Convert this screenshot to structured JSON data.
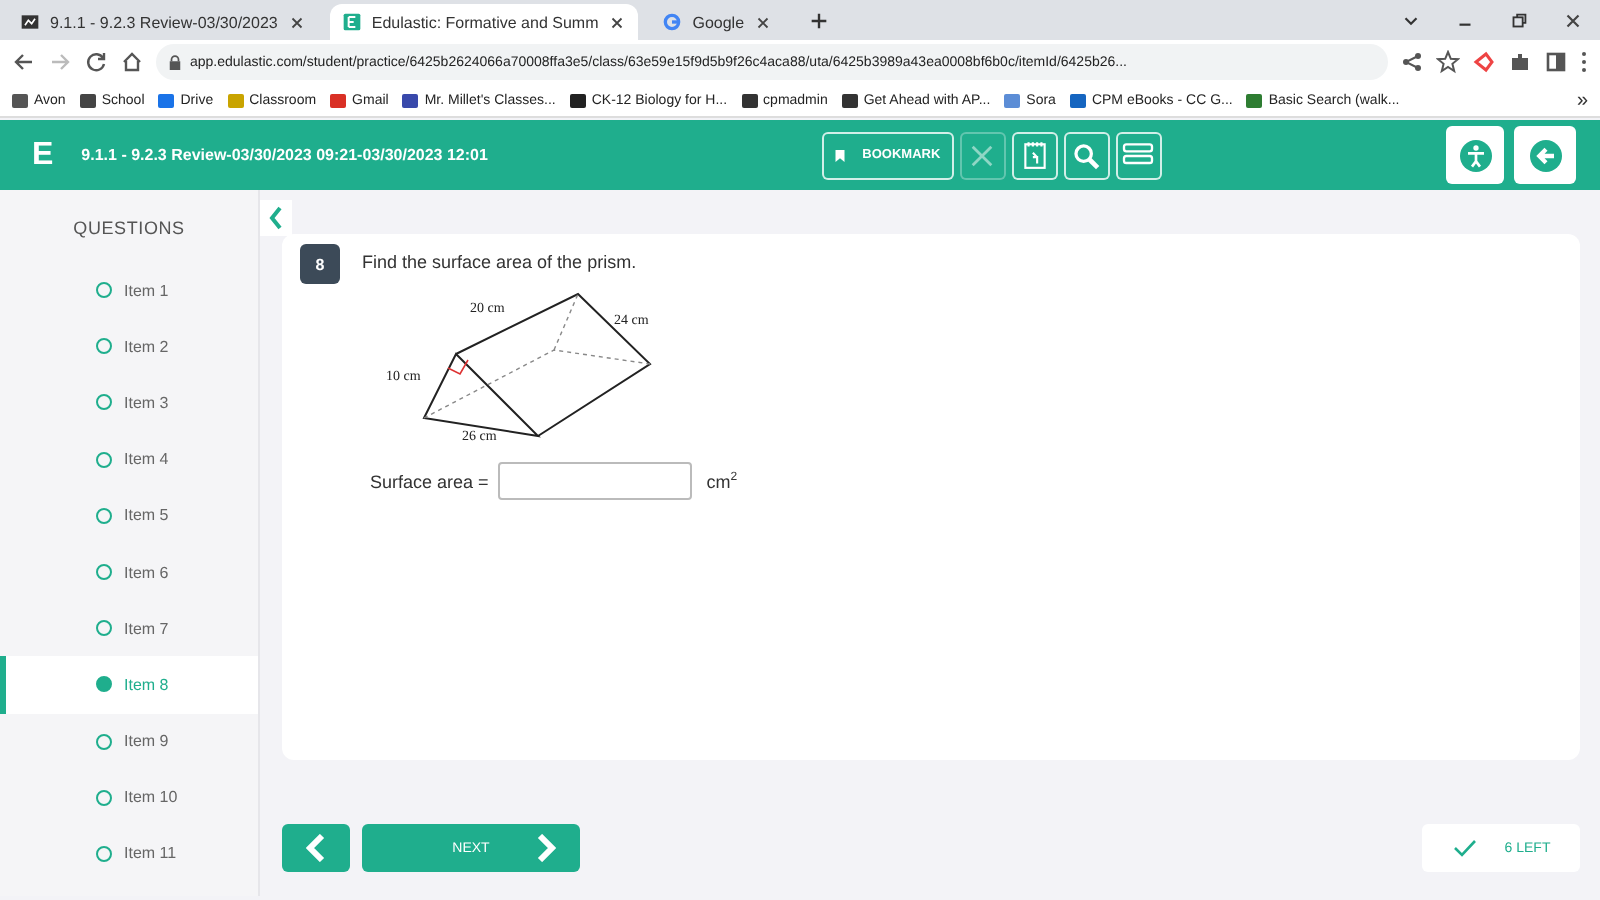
{
  "browser": {
    "tabs": [
      {
        "title": "9.1.1 - 9.2.3 Review-03/30/2023",
        "selected": false,
        "kind": "doc"
      },
      {
        "title": "Edulastic: Formative and Summ",
        "selected": true,
        "kind": "edu"
      },
      {
        "title": "Google",
        "selected": false,
        "kind": "google"
      }
    ],
    "address": "app.edulastic.com/student/practice/6425b2624066a70008ffa3e5/class/63e59e15f9d5b9f26c4aca88/uta/6425b3989a43ea0008bf6b0c/itemId/6425b26...",
    "bookmarks": [
      "Avon",
      "School",
      "Drive",
      "Classroom",
      "Gmail",
      "Mr. Millet's Classes...",
      "CK-12 Biology for H...",
      "cpmadmin",
      "Get Ahead with AP...",
      "Sora",
      "CPM eBooks - CC G...",
      "Basic Search (walk..."
    ],
    "more": "»"
  },
  "header": {
    "logo": "E",
    "title": "9.1.1 - 9.2.3 Review-03/30/2023 09:21-03/30/2023 12:01",
    "bookmark": "BOOKMARK"
  },
  "sidebar": {
    "title": "QUESTIONS",
    "items": [
      {
        "label": "Item 1",
        "selected": false
      },
      {
        "label": "Item 2",
        "selected": false
      },
      {
        "label": "Item 3",
        "selected": false
      },
      {
        "label": "Item 4",
        "selected": false
      },
      {
        "label": "Item 5",
        "selected": false
      },
      {
        "label": "Item 6",
        "selected": false
      },
      {
        "label": "Item 7",
        "selected": false
      },
      {
        "label": "Item 8",
        "selected": true
      },
      {
        "label": "Item 9",
        "selected": false
      },
      {
        "label": "Item 10",
        "selected": false
      },
      {
        "label": "Item 11",
        "selected": false
      }
    ]
  },
  "question": {
    "number": "8",
    "prompt": "Find the surface area of the prism.",
    "figure_labels": [
      "20 cm",
      "24 cm",
      "10 cm",
      "26 cm"
    ],
    "answer_label": "Surface area =",
    "unit": "cm$^{2}$"
  },
  "footer": {
    "next": "NEXT",
    "left": "6 LEFT"
  }
}
